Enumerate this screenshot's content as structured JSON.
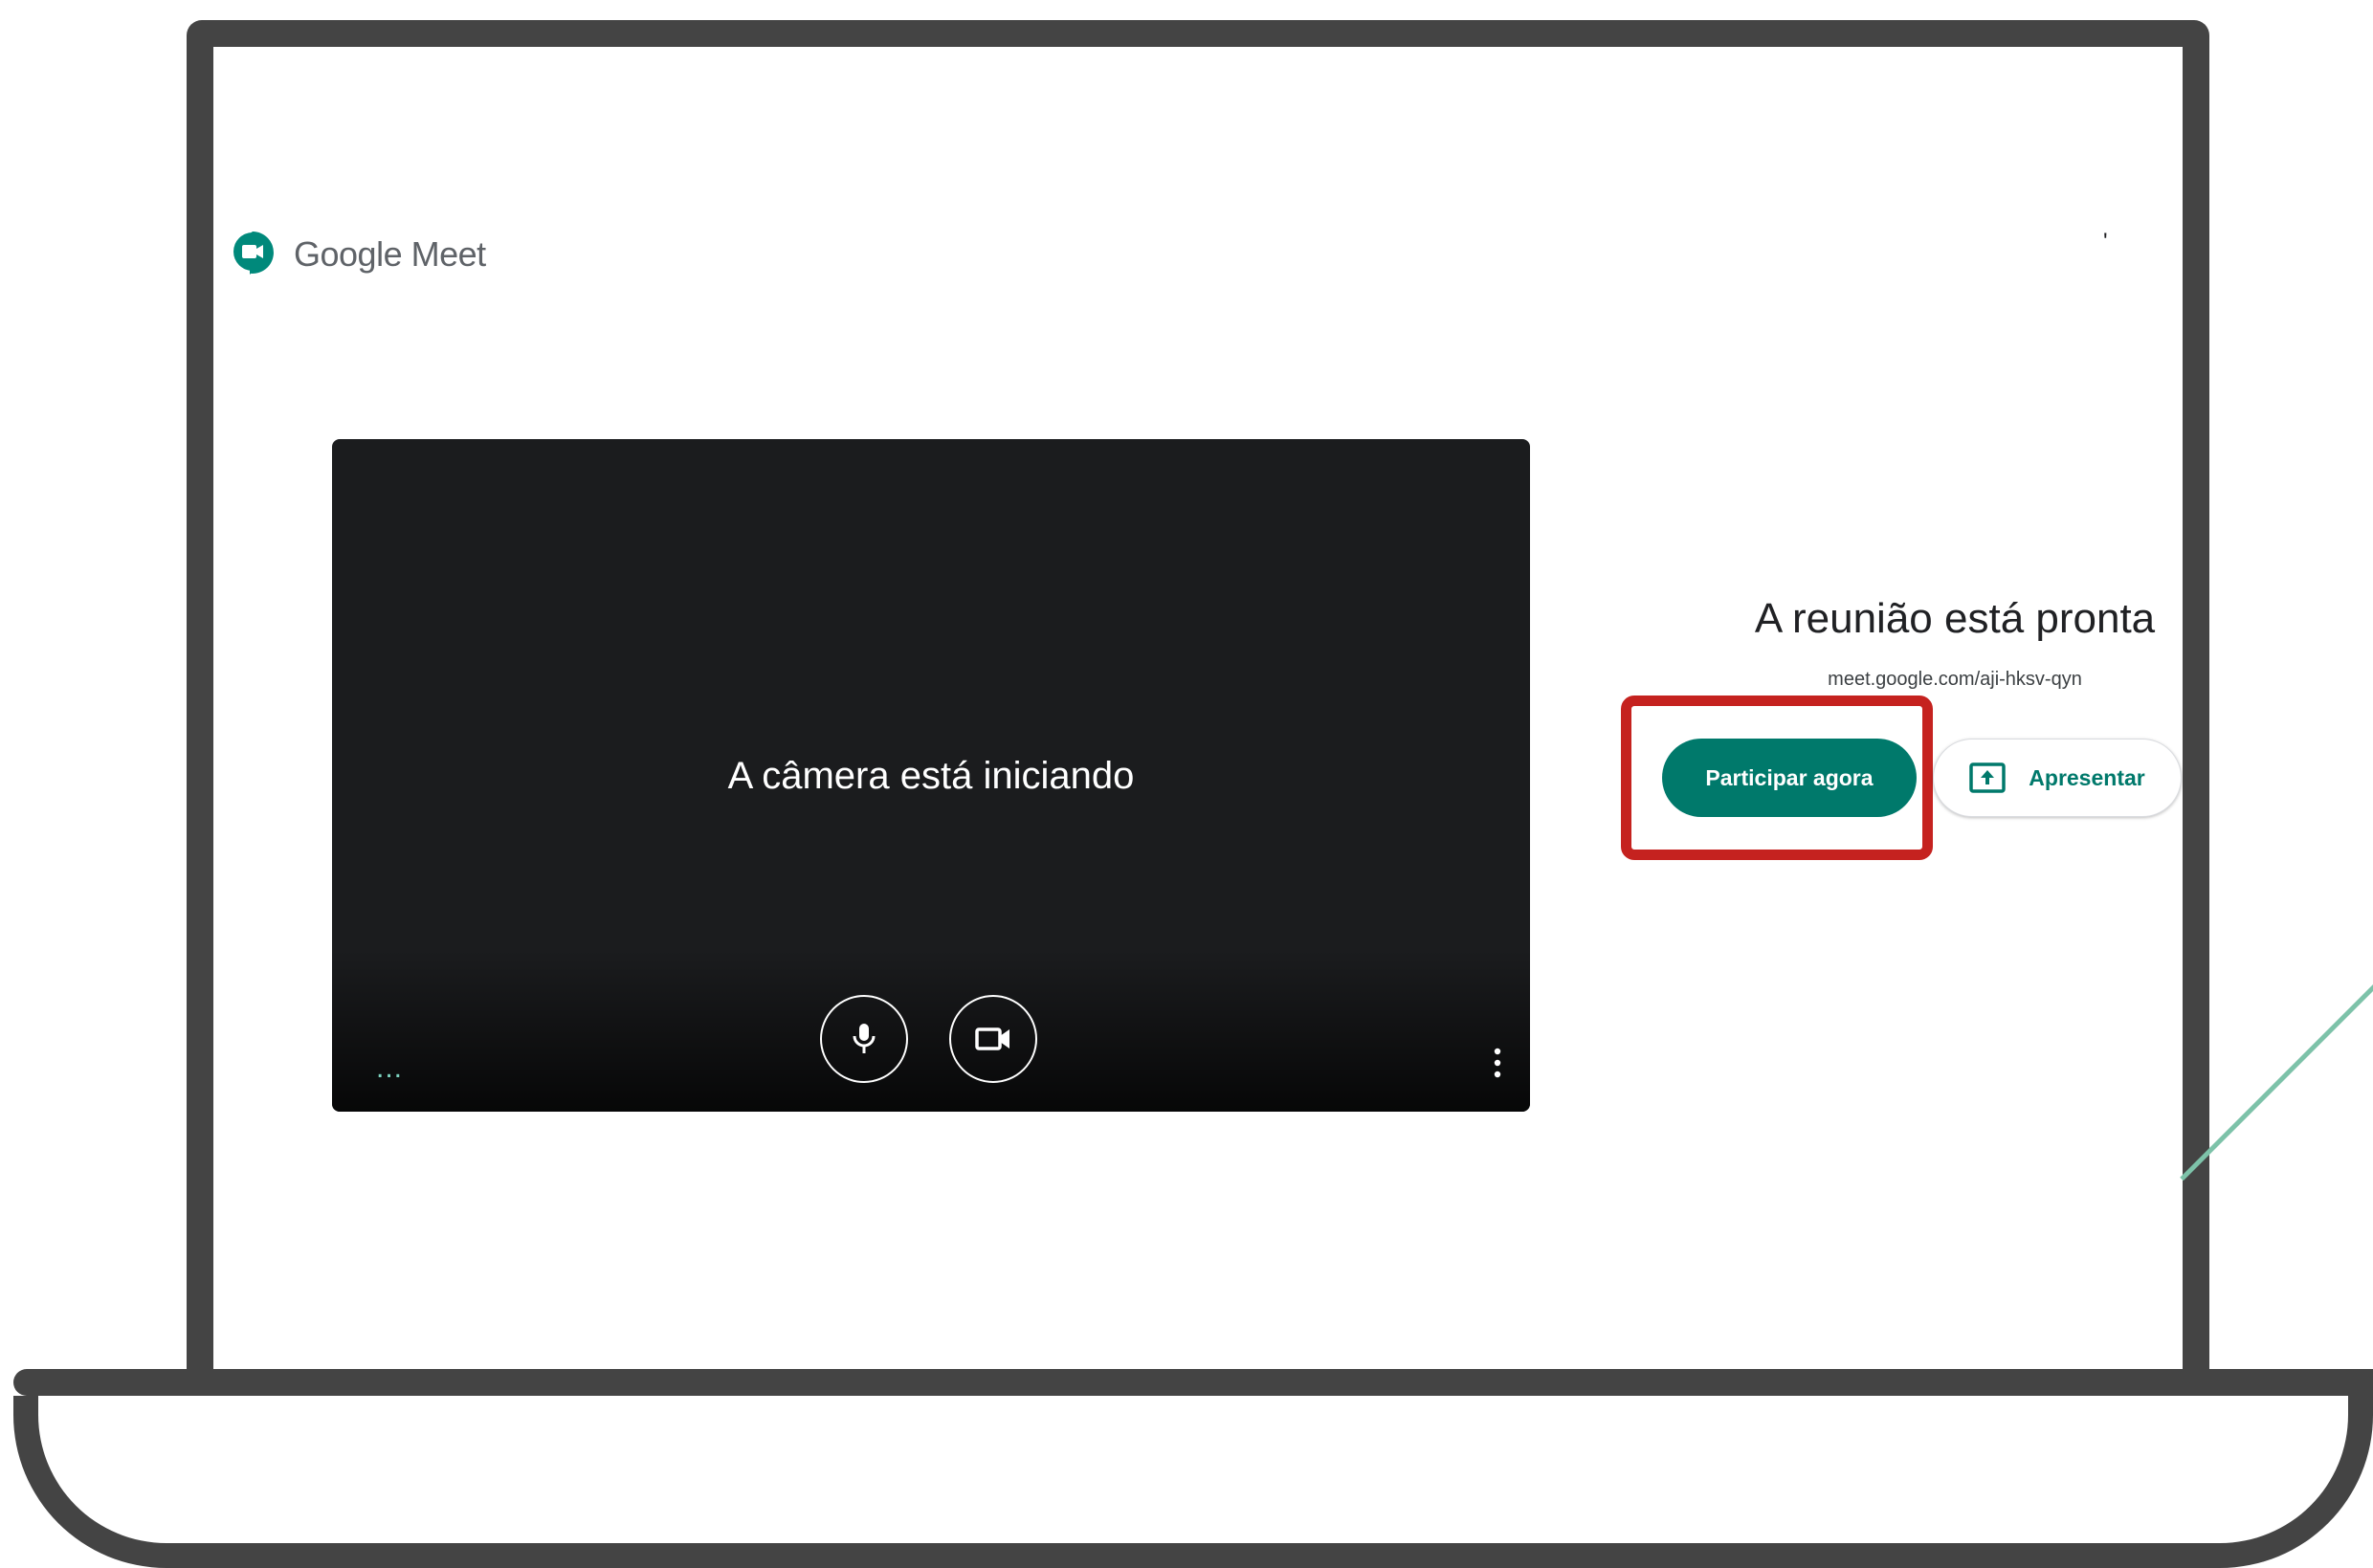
{
  "header": {
    "brand": "Google Meet",
    "mark": "'"
  },
  "preview": {
    "status": "A câmera está iniciando",
    "more": "...",
    "mic_icon": "microphone-icon",
    "camera_icon": "videocam-icon",
    "options_icon": "more-vert-icon"
  },
  "panel": {
    "title": "A reunião está pronta",
    "link": "meet.google.com/aji-hksv-qyn",
    "join_label": "Participar agora",
    "present_label": "Apresentar",
    "present_icon": "present-to-all-icon"
  },
  "colors": {
    "accent": "#00796b",
    "highlight": "#c5221f",
    "frame": "#444444",
    "video_bg": "#1b1c1e"
  }
}
